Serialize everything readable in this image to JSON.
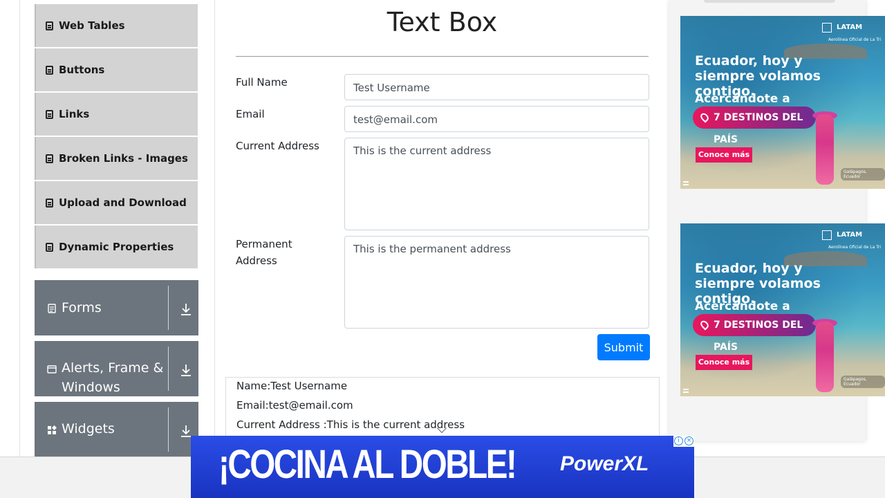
{
  "sidebar": {
    "elements": [
      {
        "label": "Web Tables"
      },
      {
        "label": "Buttons"
      },
      {
        "label": "Links"
      },
      {
        "label": "Broken Links - Images"
      },
      {
        "label": "Upload and Download"
      },
      {
        "label": "Dynamic Properties"
      }
    ],
    "groups": [
      {
        "label": "Forms",
        "icon": "document-icon"
      },
      {
        "label": "Alerts, Frame & Windows",
        "icon": "window-icon"
      },
      {
        "label": "Widgets",
        "icon": "widgets-icon"
      }
    ]
  },
  "main": {
    "title": "Text Box",
    "form": {
      "full_name_label": "Full Name",
      "full_name_value": "Test Username",
      "email_label": "Email",
      "email_value": "test@email.com",
      "current_address_label": "Current Address",
      "current_address_value": "This is the current address",
      "permanent_address_label": "Permanent Address",
      "permanent_address_value": "This is the permanent address",
      "submit_label": "Submit"
    },
    "output": {
      "name_line": "Name:Test Username",
      "email_line": "Email:test@email.com",
      "current_address_line": "Current Address :This is the current address"
    }
  },
  "ads": {
    "side_ad": {
      "brand": "LATAM",
      "brand_sub": "AIRLINES",
      "brand_tag": "Aerolínea Oficial de La Tri",
      "headline": "Ecuador, hoy y siempre volamos contigo.",
      "subheadline": "Acercándote a",
      "pill_text": "7 DESTINOS DEL PAÍS",
      "cta": "Conoce más",
      "location": "Galápagos, Ecuador"
    },
    "banner": {
      "headline": "¡COCINA AL DOBLE!",
      "brand": "PowerXL"
    }
  },
  "colors": {
    "sidebar_item_bg": "#d3d3d3",
    "group_bg": "#6c757d",
    "submit_bg": "#007bff",
    "banner_bg": "#2a4de6",
    "ad_pink": "#e8175d"
  }
}
